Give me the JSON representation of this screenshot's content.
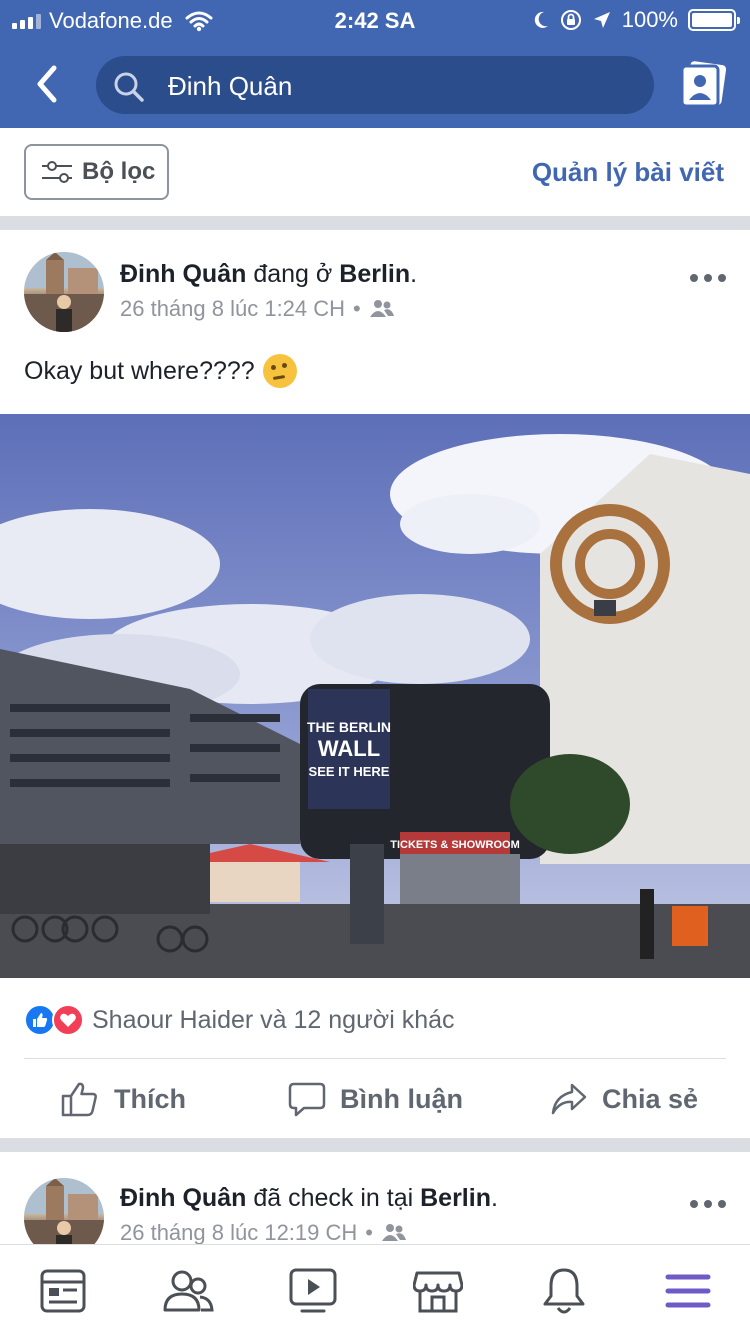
{
  "status_bar": {
    "carrier": "Vodafone.de",
    "time": "2:42 SA",
    "battery": "100%",
    "battery_level": 1.0
  },
  "nav": {
    "back_icon": "chevron-left-icon",
    "search_text": "Đinh Quân",
    "profile_icon": "profile-card-icon"
  },
  "filter_bar": {
    "filter_label": "Bộ lọc",
    "manage_posts_label": "Quản lý bài viết"
  },
  "posts": [
    {
      "author": "Đinh Quân",
      "action": "đang ở",
      "place": "Berlin",
      "punct": ".",
      "timestamp": "26 tháng 8 lúc 1:24 CH",
      "privacy_icon": "friends-icon",
      "text": "Okay but where????",
      "emoji": "thinking-face-icon",
      "photo_sign_1": "THE BERLIN WALL SEE IT HERE",
      "photo_sign_2": "TICKETS & SHOWROOM",
      "reactions_text": "Shaour Haider và 12 người khác",
      "actions": {
        "like": "Thích",
        "comment": "Bình luận",
        "share": "Chia sẻ"
      }
    },
    {
      "author": "Đinh Quân",
      "action": "đã check in tại",
      "place": "Berlin",
      "punct": ".",
      "timestamp": "26 tháng 8 lúc 12:19 CH",
      "privacy_icon": "friends-icon"
    }
  ],
  "tab_bar": {
    "icons": [
      "news-feed-icon",
      "friends-icon",
      "watch-icon",
      "marketplace-icon",
      "notifications-icon",
      "menu-icon"
    ],
    "active_index": 5,
    "accent": "#4267b2",
    "active_color": "#6f5bc5"
  },
  "colors": {
    "brand_blue": "#4267b2",
    "search_bg": "#2c4d8c",
    "link_blue": "#4267b2",
    "like_blue": "#1877f2",
    "love_red": "#f33e58"
  }
}
